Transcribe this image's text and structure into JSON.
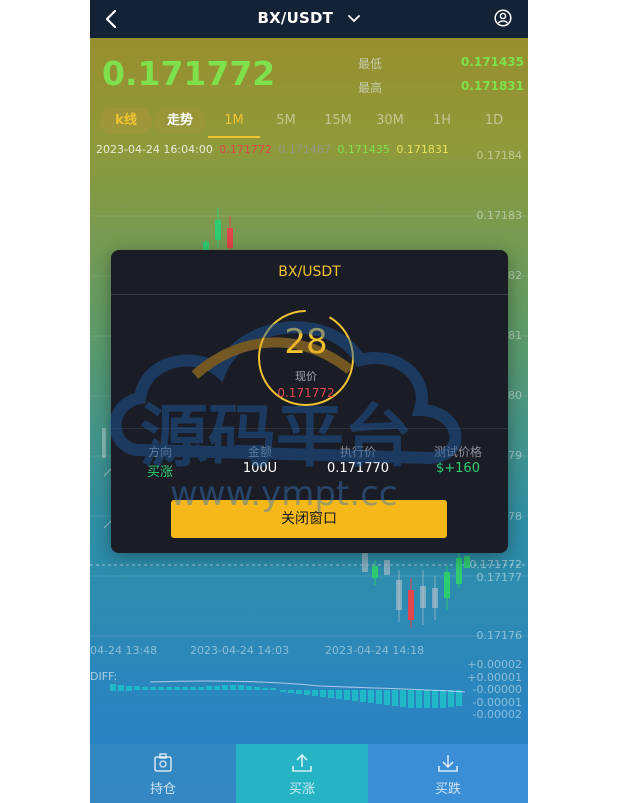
{
  "navbar": {
    "title": "BX/USDT"
  },
  "ticker": {
    "price": "0.171772",
    "low_label": "最低",
    "low_value": "0.171435",
    "high_label": "最高",
    "high_value": "0.171831"
  },
  "tabs": [
    "k线",
    "走势",
    "1M",
    "5M",
    "15M",
    "30M",
    "1H",
    "1D"
  ],
  "ohlc": {
    "datetime": "2023-04-24 16:04:00",
    "open": "0.171772",
    "close": "0.171487",
    "low": "0.171435",
    "high": "0.171831"
  },
  "chart": {
    "price_ticks": [
      "0.17184",
      "0.17183",
      "82",
      "81",
      "80",
      "79",
      "78",
      "0.171772",
      "0.17177",
      "0.17176"
    ],
    "time_ticks": [
      "04-24 13:48",
      "2023-04-24 14:03",
      "2023-04-24 14:18"
    ],
    "diff_label": "DIFF:",
    "macd_ticks": [
      "+0.00002",
      "+0.00001",
      "-0.00000",
      "-0.00001",
      "-0.00002"
    ]
  },
  "watermark": {
    "text_cn": "源码平台",
    "text_url": "www.ympt.cc"
  },
  "modal": {
    "title": "BX/USDT",
    "countdown": "28",
    "current_label": "现价",
    "current_value": "0.171772",
    "columns": [
      {
        "label": "方向",
        "value": "买涨"
      },
      {
        "label": "金额",
        "value": "100U"
      },
      {
        "label": "执行价",
        "value": "0.171770"
      },
      {
        "label": "测试价格",
        "value": "$+160"
      }
    ],
    "close_label": "关闭窗口"
  },
  "bottom": {
    "hold": "持仓",
    "buy_up": "买涨",
    "buy_down": "买跌"
  },
  "colors": {
    "accent": "#f0c330",
    "up": "#2ecc71",
    "down": "#e0464a",
    "price": "#7ee04c"
  }
}
